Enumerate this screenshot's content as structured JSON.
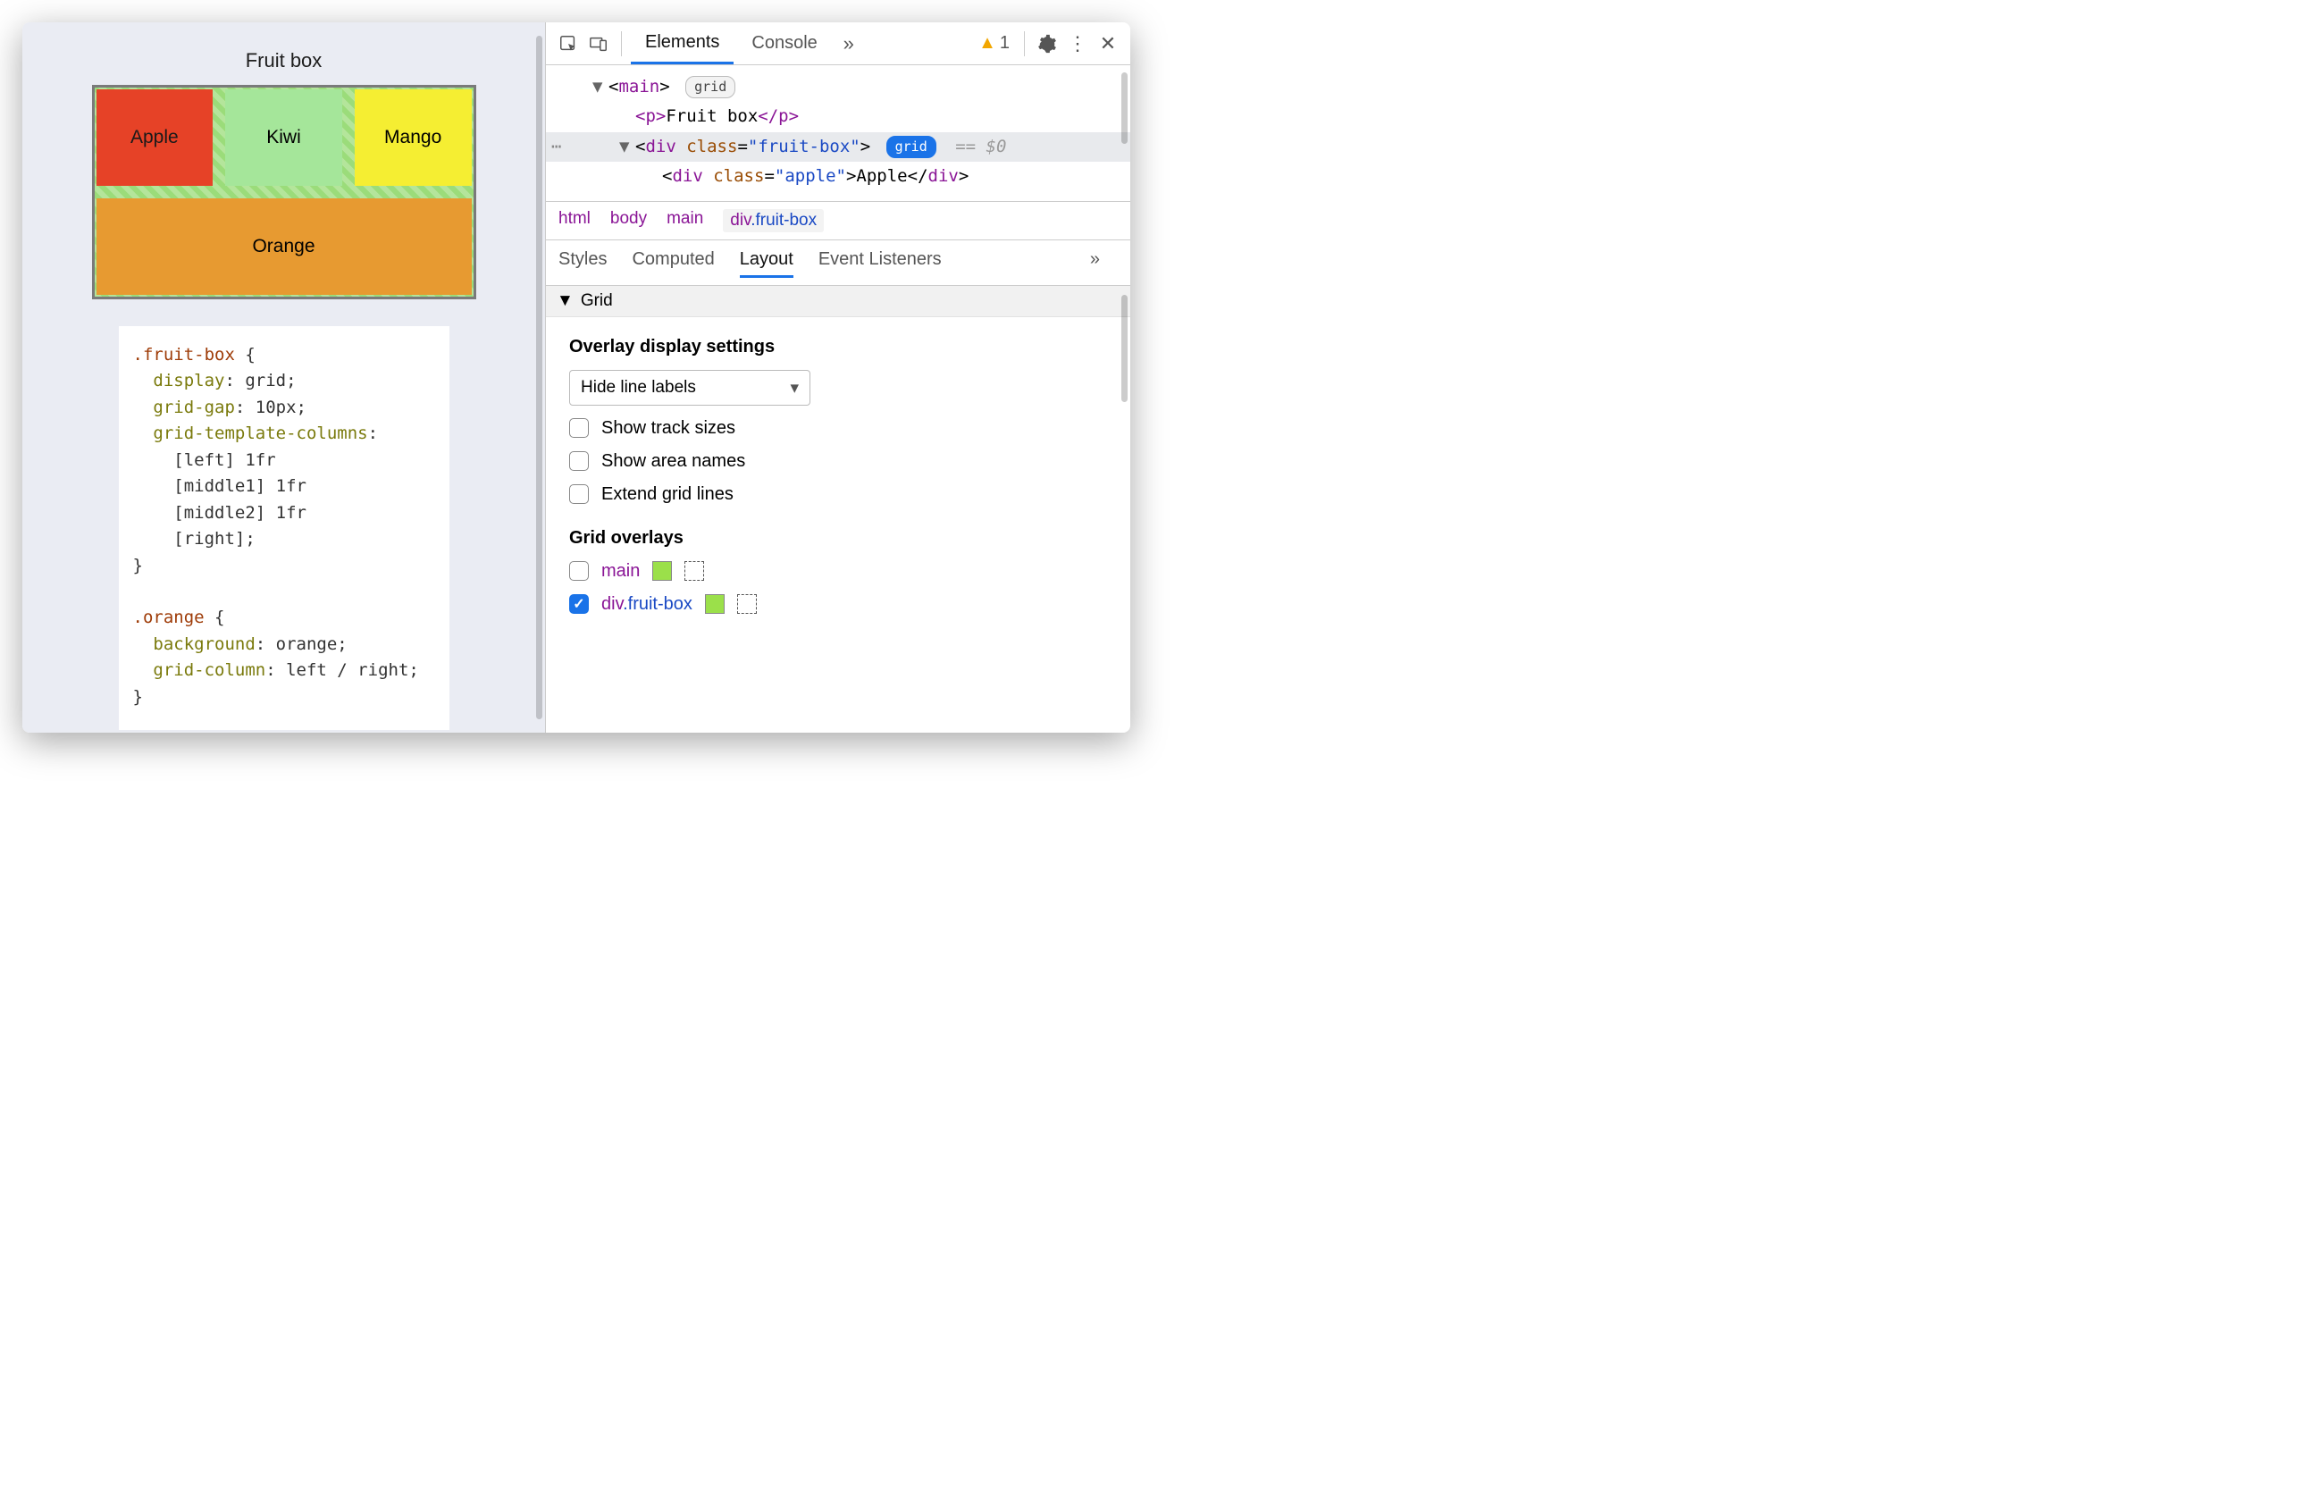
{
  "page": {
    "title": "Fruit box",
    "fruits": {
      "apple": "Apple",
      "kiwi": "Kiwi",
      "mango": "Mango",
      "orange": "Orange"
    },
    "css": ".fruit-box {\n  display: grid;\n  grid-gap: 10px;\n  grid-template-columns:\n    [left] 1fr\n    [middle1] 1fr\n    [middle2] 1fr\n    [right];\n}\n\n.orange {\n  background: orange;\n  grid-column: left / right;\n}"
  },
  "toolbar": {
    "tabs": {
      "elements": "Elements",
      "console": "Console"
    },
    "warn_count": "1"
  },
  "dom": {
    "main_tag": "main",
    "main_badge": "grid",
    "p_open": "<p>",
    "p_text": "Fruit box",
    "p_close": "</p>",
    "div_open_tag": "div",
    "div_class_attr": "class",
    "div_class_val": "\"fruit-box\"",
    "div_badge": "grid",
    "sel_hint": "== $0",
    "apple_open_tag": "div",
    "apple_class_attr": "class",
    "apple_class_val": "\"apple\"",
    "apple_text": "Apple"
  },
  "crumbs": {
    "c0": "html",
    "c1": "body",
    "c2": "main",
    "c3_tag": "div",
    "c3_cls": ".fruit-box"
  },
  "subtabs": {
    "styles": "Styles",
    "computed": "Computed",
    "layout": "Layout",
    "eventlisteners": "Event Listeners"
  },
  "layout": {
    "section": "Grid",
    "settings_title": "Overlay display settings",
    "select_value": "Hide line labels",
    "opt_track": "Show track sizes",
    "opt_area": "Show area names",
    "opt_extend": "Extend grid lines",
    "overlays_title": "Grid overlays",
    "ov_main": "main",
    "ov_fb_tag": "div",
    "ov_fb_cls": ".fruit-box"
  }
}
